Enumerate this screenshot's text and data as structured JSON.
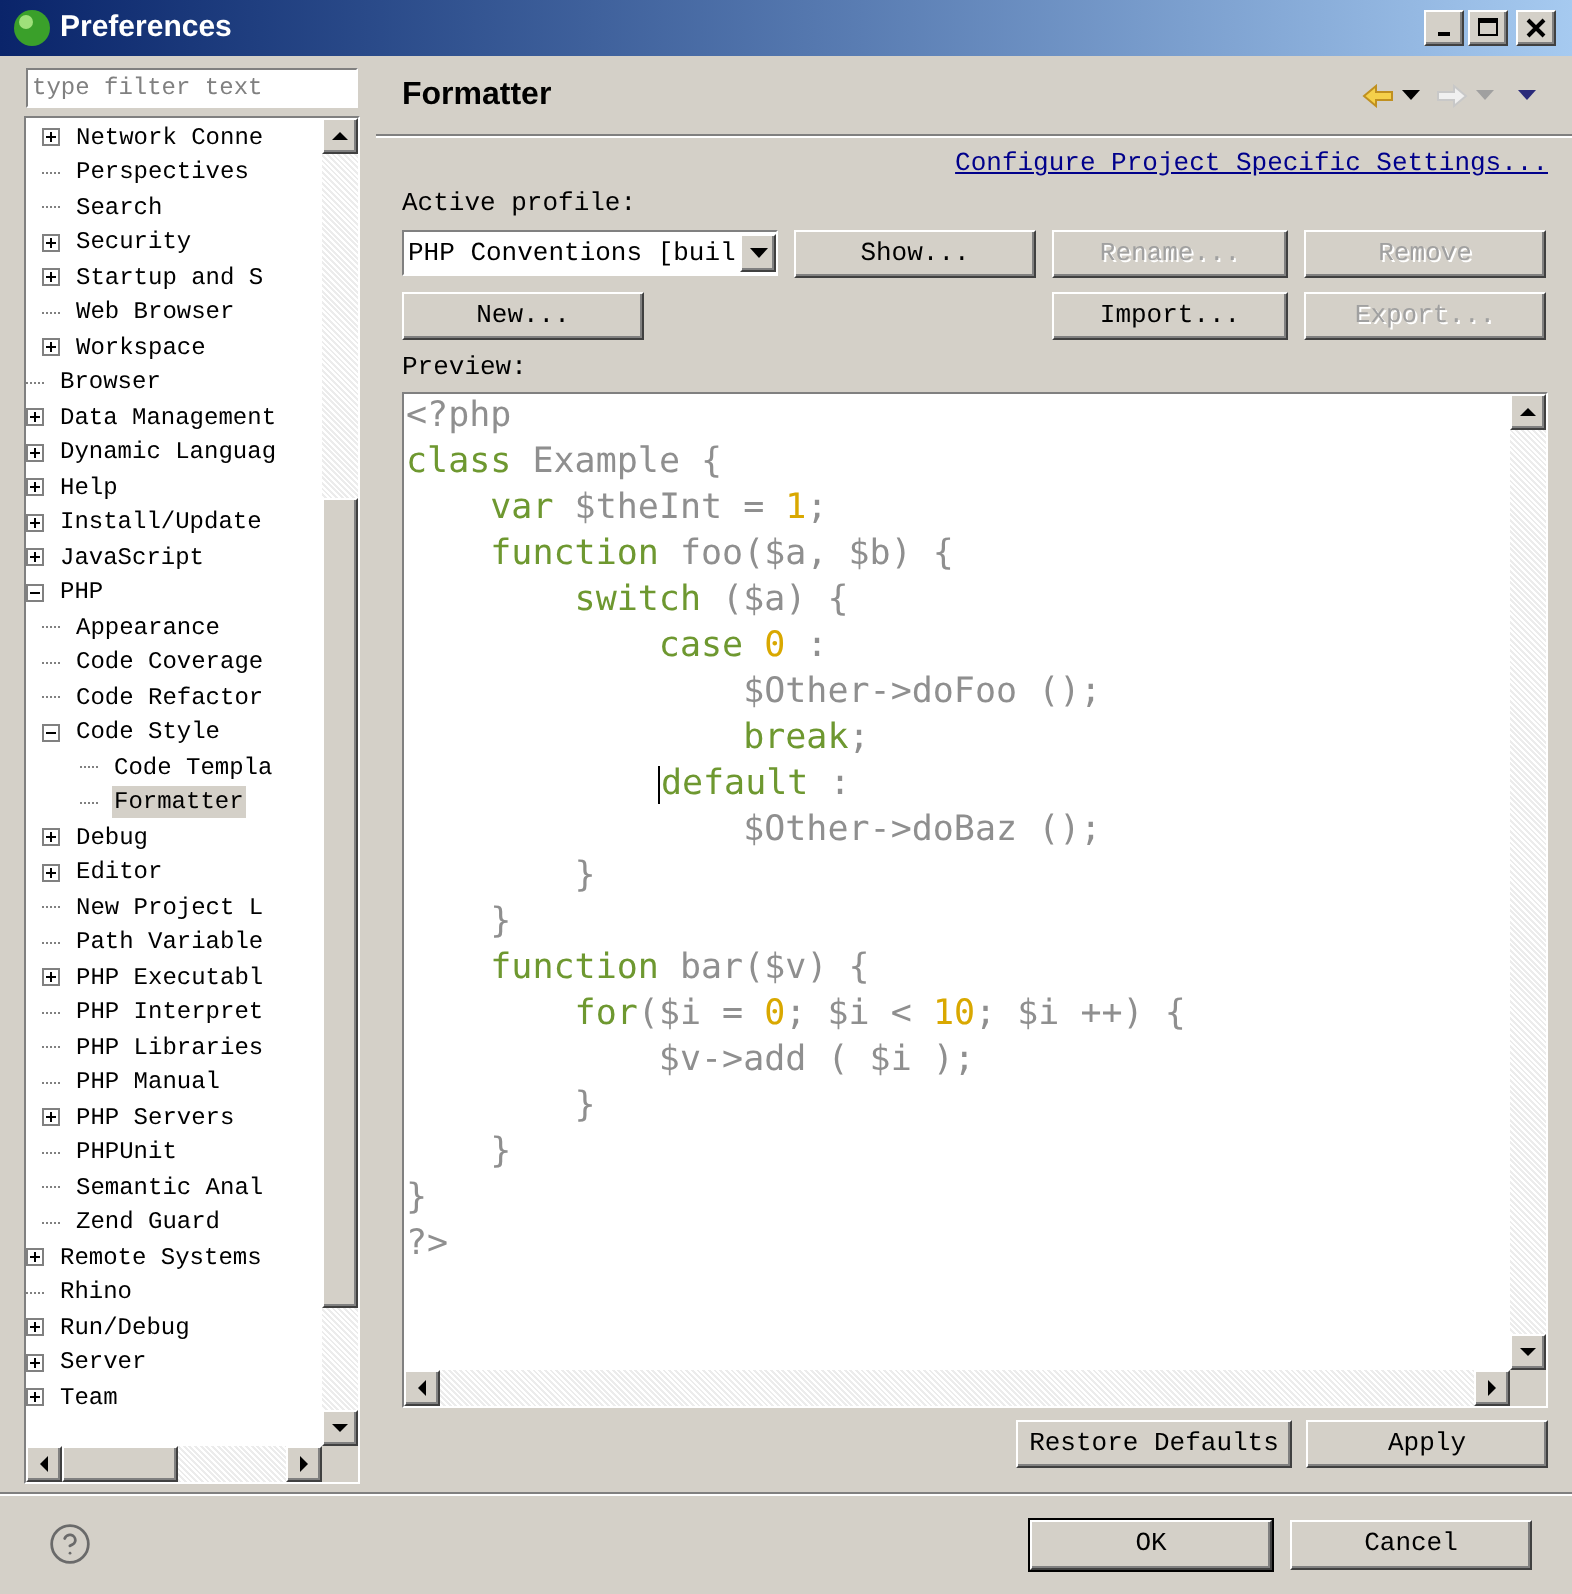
{
  "window": {
    "title": "Preferences"
  },
  "filter": {
    "placeholder": "type filter text"
  },
  "tree": [
    {
      "children": [
        {
          "label": "Network Conne",
          "expanded": false,
          "selected": false
        },
        {
          "label": "Perspectives",
          "selected": false
        },
        {
          "label": "Search",
          "selected": false
        },
        {
          "label": "Security",
          "expanded": false,
          "selected": false
        },
        {
          "label": "Startup and S",
          "expanded": false,
          "selected": false
        },
        {
          "label": "Web Browser",
          "selected": false
        },
        {
          "label": "Workspace",
          "expanded": false,
          "selected": false
        }
      ]
    },
    {
      "label": "Browser",
      "selected": false
    },
    {
      "label": "Data Management",
      "expanded": false,
      "selected": false
    },
    {
      "label": "Dynamic Languag",
      "expanded": false,
      "selected": false
    },
    {
      "label": "Help",
      "expanded": false,
      "selected": false
    },
    {
      "label": "Install/Update",
      "expanded": false,
      "selected": false
    },
    {
      "label": "JavaScript",
      "expanded": false,
      "selected": false
    },
    {
      "label": "PHP",
      "expanded": true,
      "selected": false,
      "children": [
        {
          "label": "Appearance",
          "selected": false
        },
        {
          "label": "Code Coverage",
          "selected": false
        },
        {
          "label": "Code Refactor",
          "selected": false
        },
        {
          "label": "Code Style",
          "expanded": true,
          "selected": false,
          "children": [
            {
              "label": "Code Templa",
              "selected": false
            },
            {
              "label": "Formatter",
              "selected": true
            }
          ]
        },
        {
          "label": "Debug",
          "expanded": false,
          "selected": false
        },
        {
          "label": "Editor",
          "expanded": false,
          "selected": false
        },
        {
          "label": "New Project L",
          "selected": false
        },
        {
          "label": "Path Variable",
          "selected": false
        },
        {
          "label": "PHP Executabl",
          "expanded": false,
          "selected": false
        },
        {
          "label": "PHP Interpret",
          "selected": false
        },
        {
          "label": "PHP Libraries",
          "selected": false
        },
        {
          "label": "PHP Manual",
          "selected": false
        },
        {
          "label": "PHP Servers",
          "expanded": false,
          "selected": false
        },
        {
          "label": "PHPUnit",
          "selected": false
        },
        {
          "label": "Semantic Anal",
          "selected": false
        },
        {
          "label": "Zend Guard",
          "selected": false
        }
      ]
    },
    {
      "label": "Remote Systems",
      "expanded": false,
      "selected": false
    },
    {
      "label": "Rhino",
      "selected": false
    },
    {
      "label": "Run/Debug",
      "expanded": false,
      "selected": false
    },
    {
      "label": "Server",
      "expanded": false,
      "selected": false
    },
    {
      "label": "Team",
      "expanded": false,
      "selected": false
    }
  ],
  "page": {
    "title": "Formatter",
    "history": {
      "back": {
        "disabled": false
      },
      "forward": {
        "disabled": true
      }
    },
    "link": "Configure Project Specific Settings...",
    "profile_label": "Active profile:",
    "profile": {
      "value": "PHP Conventions [buil"
    },
    "profile_buttons": [
      {
        "label": "Show...",
        "disabled": false
      },
      {
        "label": "Rename...",
        "disabled": true
      },
      {
        "label": "Remove",
        "disabled": true
      }
    ],
    "actions": [
      {
        "label": "New...",
        "disabled": false
      },
      {
        "label": "Import...",
        "disabled": false
      },
      {
        "label": "Export...",
        "disabled": true
      }
    ],
    "preview_label": "Preview:",
    "code": [
      [
        {
          "kind": "plain",
          "text": "<?php"
        }
      ],
      [
        {
          "kind": "keyword",
          "text": "class"
        },
        {
          "kind": "plain",
          "text": " Example {"
        }
      ],
      [
        {
          "kind": "keyword",
          "text": "    var"
        },
        {
          "kind": "plain",
          "text": " $theInt = "
        },
        {
          "kind": "number",
          "text": "1"
        },
        {
          "kind": "plain",
          "text": ";"
        }
      ],
      [
        {
          "kind": "keyword",
          "text": "    function"
        },
        {
          "kind": "plain",
          "text": " foo($a, $b) {"
        }
      ],
      [
        {
          "kind": "keyword",
          "text": "        switch"
        },
        {
          "kind": "plain",
          "text": " ($a) {"
        }
      ],
      [
        {
          "kind": "keyword",
          "text": "            case"
        },
        {
          "kind": "number",
          "text": " 0"
        },
        {
          "kind": "plain",
          "text": " :"
        }
      ],
      [
        {
          "kind": "plain",
          "text": "                $Other->doFoo ();"
        }
      ],
      [
        {
          "kind": "keyword",
          "text": "                break"
        },
        {
          "kind": "plain",
          "text": ";"
        }
      ],
      [
        {
          "kind": "keyword",
          "text": "            default",
          "caret": true
        },
        {
          "kind": "plain",
          "text": " :"
        }
      ],
      [
        {
          "kind": "plain",
          "text": "                $Other->doBaz ();"
        }
      ],
      [
        {
          "kind": "plain",
          "text": "        }"
        }
      ],
      [
        {
          "kind": "plain",
          "text": "    }"
        }
      ],
      [
        {
          "kind": "keyword",
          "text": "    function"
        },
        {
          "kind": "plain",
          "text": " bar($v) {"
        }
      ],
      [
        {
          "kind": "keyword",
          "text": "        for"
        },
        {
          "kind": "plain",
          "text": "($i = "
        },
        {
          "kind": "number",
          "text": "0"
        },
        {
          "kind": "plain",
          "text": "; $i < "
        },
        {
          "kind": "number",
          "text": "10"
        },
        {
          "kind": "plain",
          "text": "; $i ++) {"
        }
      ],
      [
        {
          "kind": "plain",
          "text": "            $v->add ( $i );"
        }
      ],
      [
        {
          "kind": "plain",
          "text": "        }"
        }
      ],
      [
        {
          "kind": "plain",
          "text": "    }"
        }
      ],
      [
        {
          "kind": "plain",
          "text": "}"
        }
      ],
      [
        {
          "kind": "plain",
          "text": "?>"
        }
      ]
    ],
    "page_buttons": [
      {
        "label": "Restore Defaults"
      },
      {
        "label": "Apply"
      }
    ]
  },
  "dialog_buttons": [
    {
      "label": "OK",
      "default": true
    },
    {
      "label": "Cancel",
      "default": false
    }
  ]
}
